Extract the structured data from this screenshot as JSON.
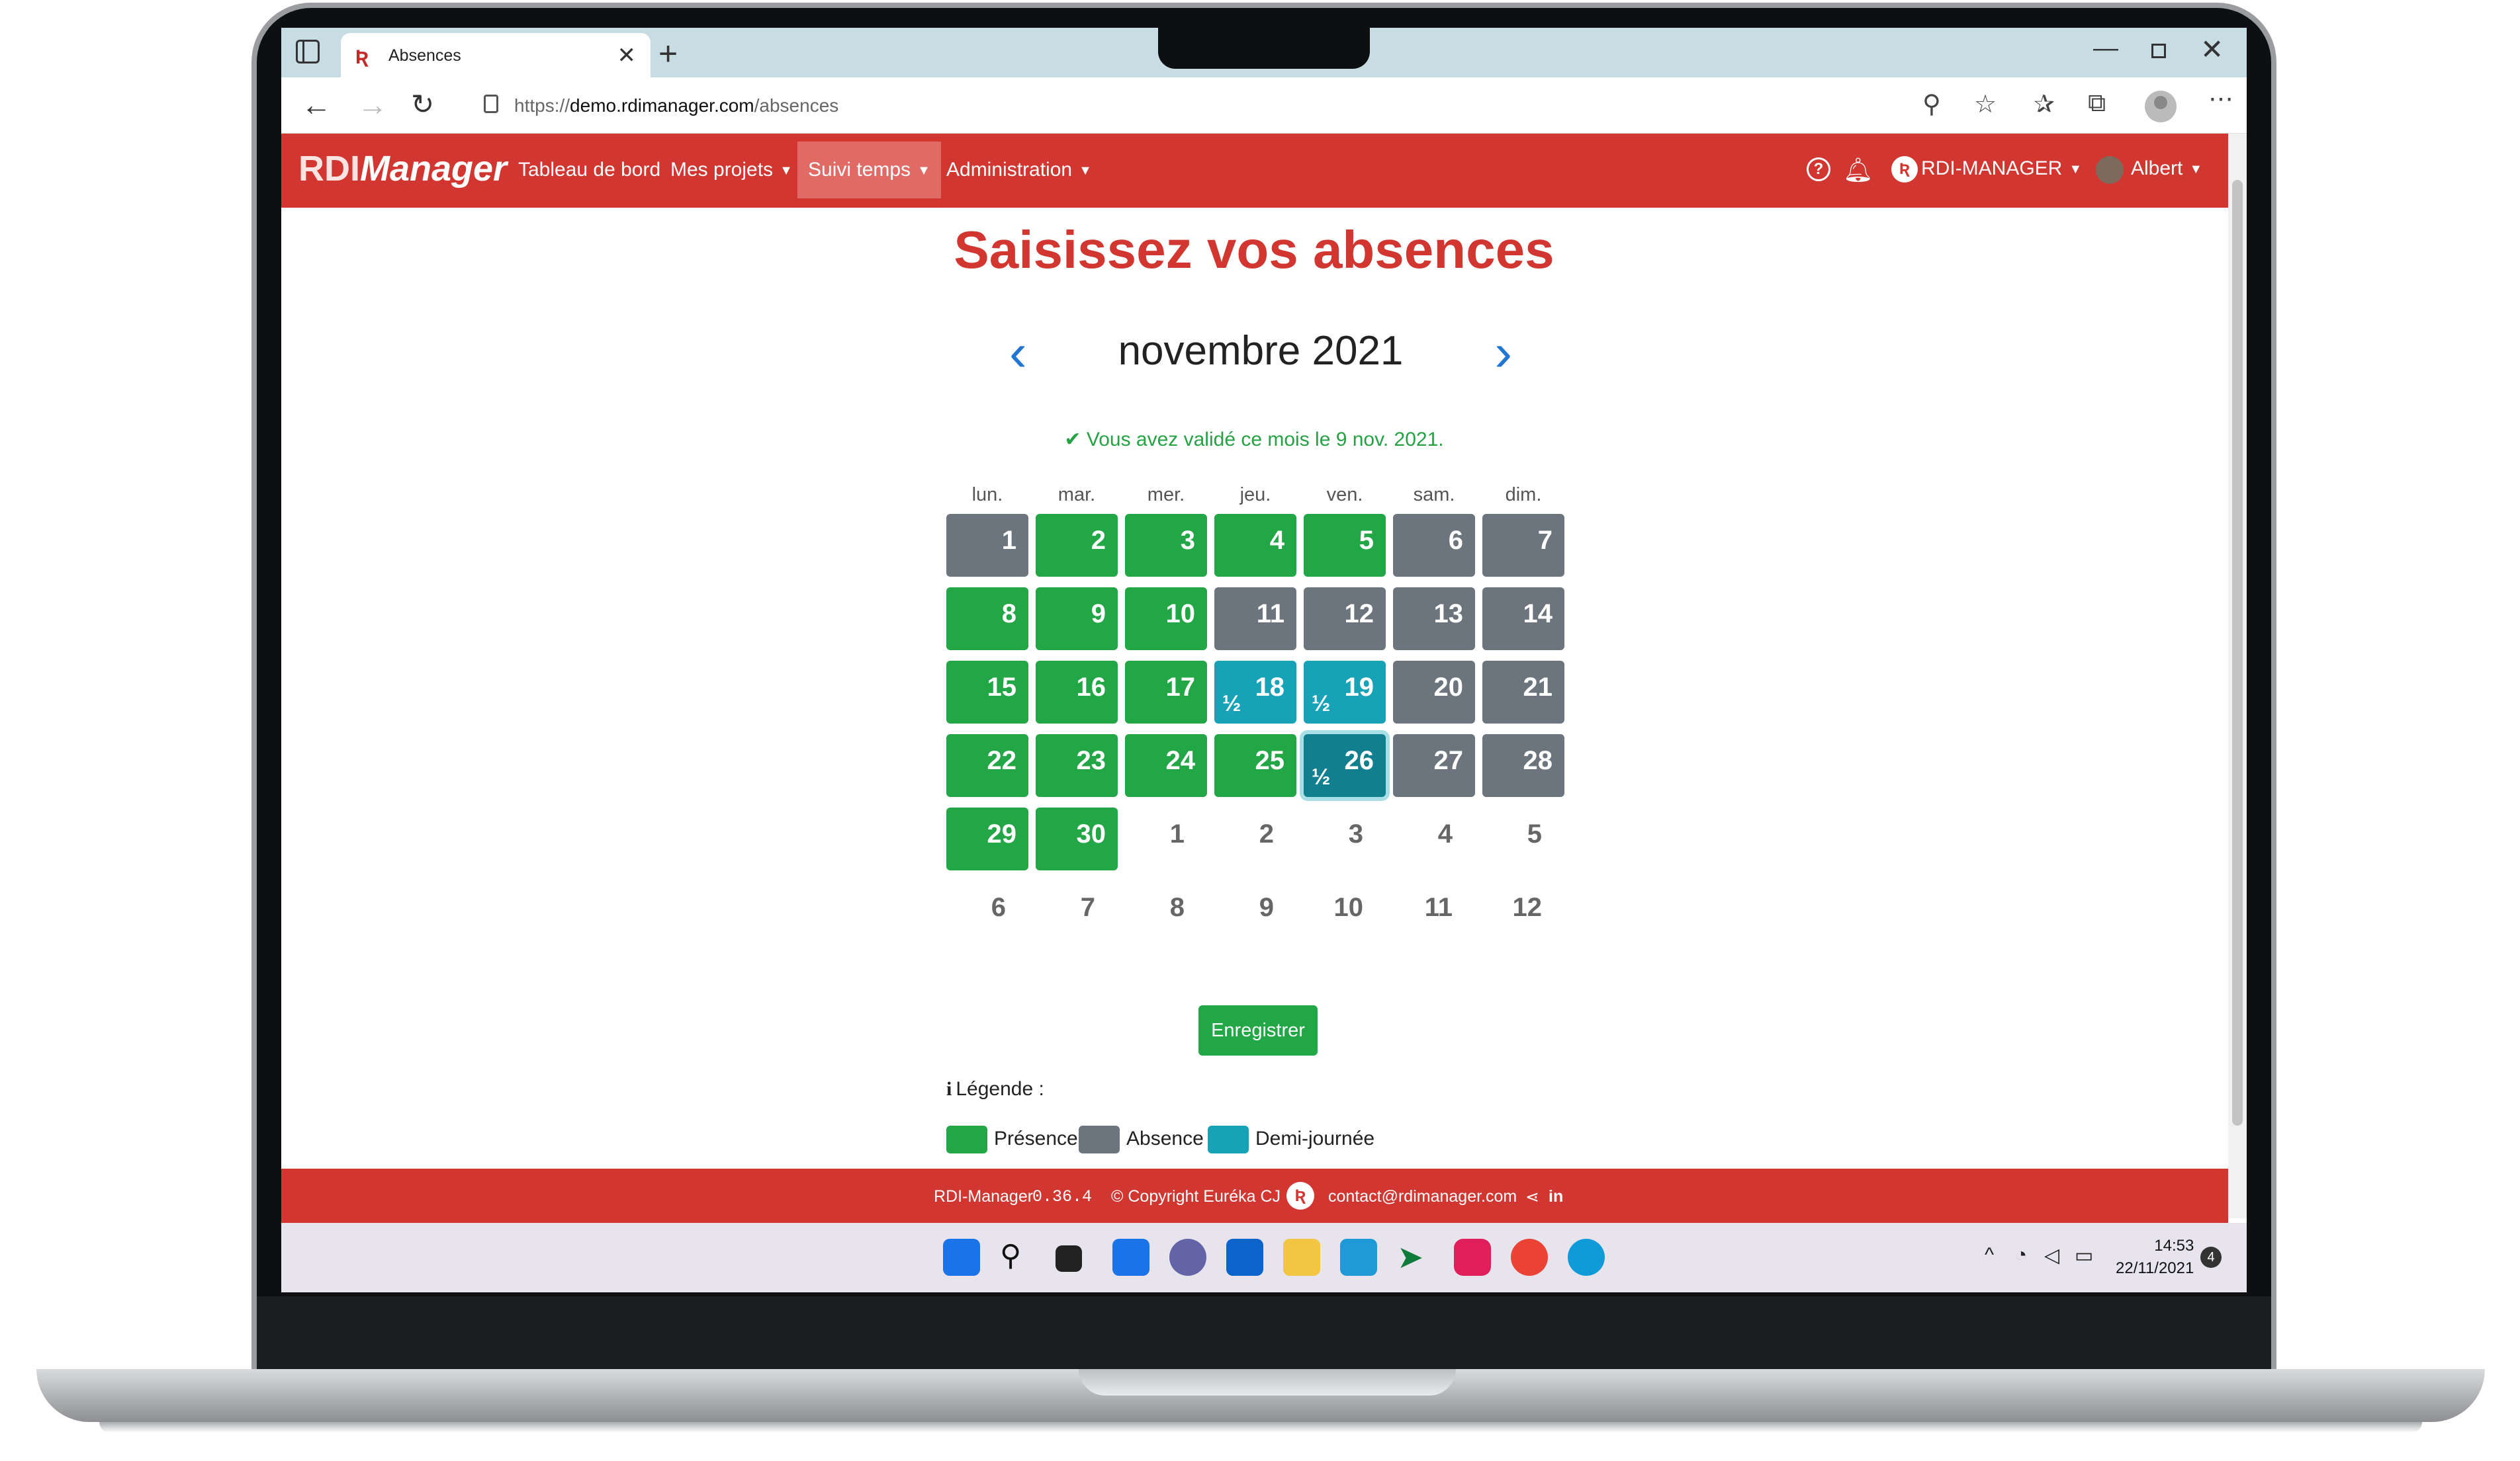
{
  "browser": {
    "tab_title": "Absences",
    "url_prefix": "https://",
    "url_host": "demo.rdimanager.com",
    "url_path": "/absences"
  },
  "navbar": {
    "brand_rdi": "RDI",
    "brand_manager": "Manager",
    "links": [
      "Tableau de bord",
      "Mes projets",
      "Suivi temps",
      "Administration"
    ],
    "org": "RDI-MANAGER",
    "user": "Albert"
  },
  "page": {
    "title": "Saisissez vos absences",
    "month": "novembre 2021",
    "validated_message": "Vous avez validé ce mois le 9 nov. 2021."
  },
  "calendar": {
    "weekdays": [
      "lun.",
      "mar.",
      "mer.",
      "jeu.",
      "ven.",
      "sam.",
      "dim."
    ],
    "half_symbol": "½",
    "weeks": [
      [
        {
          "d": "1",
          "s": "absence"
        },
        {
          "d": "2",
          "s": "presence"
        },
        {
          "d": "3",
          "s": "presence"
        },
        {
          "d": "4",
          "s": "presence"
        },
        {
          "d": "5",
          "s": "presence"
        },
        {
          "d": "6",
          "s": "absence"
        },
        {
          "d": "7",
          "s": "absence"
        }
      ],
      [
        {
          "d": "8",
          "s": "presence"
        },
        {
          "d": "9",
          "s": "presence"
        },
        {
          "d": "10",
          "s": "presence"
        },
        {
          "d": "11",
          "s": "absence"
        },
        {
          "d": "12",
          "s": "absence"
        },
        {
          "d": "13",
          "s": "absence"
        },
        {
          "d": "14",
          "s": "absence"
        }
      ],
      [
        {
          "d": "15",
          "s": "presence"
        },
        {
          "d": "16",
          "s": "presence"
        },
        {
          "d": "17",
          "s": "presence"
        },
        {
          "d": "18",
          "s": "half-day"
        },
        {
          "d": "19",
          "s": "half-day"
        },
        {
          "d": "20",
          "s": "absence"
        },
        {
          "d": "21",
          "s": "absence"
        }
      ],
      [
        {
          "d": "22",
          "s": "presence"
        },
        {
          "d": "23",
          "s": "presence"
        },
        {
          "d": "24",
          "s": "presence"
        },
        {
          "d": "25",
          "s": "presence"
        },
        {
          "d": "26",
          "s": "half-day selected"
        },
        {
          "d": "27",
          "s": "absence"
        },
        {
          "d": "28",
          "s": "absence"
        }
      ],
      [
        {
          "d": "29",
          "s": "presence"
        },
        {
          "d": "30",
          "s": "presence"
        },
        {
          "d": "1",
          "s": "other"
        },
        {
          "d": "2",
          "s": "other"
        },
        {
          "d": "3",
          "s": "other"
        },
        {
          "d": "4",
          "s": "other"
        },
        {
          "d": "5",
          "s": "other"
        }
      ],
      [
        {
          "d": "6",
          "s": "other"
        },
        {
          "d": "7",
          "s": "other"
        },
        {
          "d": "8",
          "s": "other"
        },
        {
          "d": "9",
          "s": "other"
        },
        {
          "d": "10",
          "s": "other"
        },
        {
          "d": "11",
          "s": "other"
        },
        {
          "d": "12",
          "s": "other"
        }
      ]
    ]
  },
  "save_label": "Enregistrer",
  "legend": {
    "title": "Légende :",
    "info_glyph": "i",
    "items": [
      {
        "label": "Présence",
        "color": "#22a646"
      },
      {
        "label": "Absence",
        "color": "#6c757d"
      },
      {
        "label": "Demi-journée",
        "color": "#17a2b8"
      }
    ]
  },
  "footer": {
    "app": "RDI-Manager",
    "version": "0.36.4",
    "copyright": "© Copyright Euréka CJ",
    "email": "contact@rdimanager.com"
  },
  "taskbar": {
    "time": "14:53",
    "date": "22/11/2021",
    "notifications": "4"
  },
  "colors": {
    "brand_red": "#d23630",
    "presence": "#22a646",
    "absence": "#6c757d",
    "half_day": "#17a2b8",
    "link_blue": "#2176d2"
  }
}
